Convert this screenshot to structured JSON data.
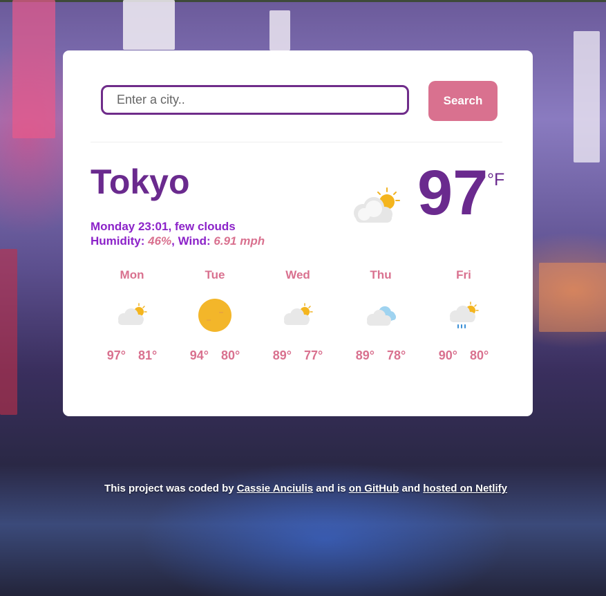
{
  "search": {
    "placeholder": "Enter a city..",
    "button_label": "Search"
  },
  "current": {
    "city": "Tokyo",
    "day_time": "Monday 23:01",
    "description": "few clouds",
    "humidity_label": "Humidity:",
    "humidity_value": "46%",
    "wind_label": "Wind:",
    "wind_value": "6.91 mph",
    "temperature": "97",
    "unit": "°F",
    "icon": "few-clouds-icon"
  },
  "forecast": [
    {
      "day": "Mon",
      "max": "97°",
      "min": "81°",
      "icon": "few-clouds-icon"
    },
    {
      "day": "Tue",
      "max": "94°",
      "min": "80°",
      "icon": "clear-sun-icon"
    },
    {
      "day": "Wed",
      "max": "89°",
      "min": "77°",
      "icon": "few-clouds-icon"
    },
    {
      "day": "Thu",
      "max": "89°",
      "min": "78°",
      "icon": "clouds-icon"
    },
    {
      "day": "Fri",
      "max": "90°",
      "min": "80°",
      "icon": "rain-icon"
    }
  ],
  "footer": {
    "prefix": "This project was coded by",
    "author_link": "Cassie Anciulis",
    "middle": "and is",
    "github_link": "on GitHub",
    "and_text": "and",
    "netlify_link": "hosted on Netlify"
  },
  "colors": {
    "accent_purple": "#6a2a8e",
    "accent_pink": "#d9718f",
    "details_purple": "#8c23c9"
  }
}
